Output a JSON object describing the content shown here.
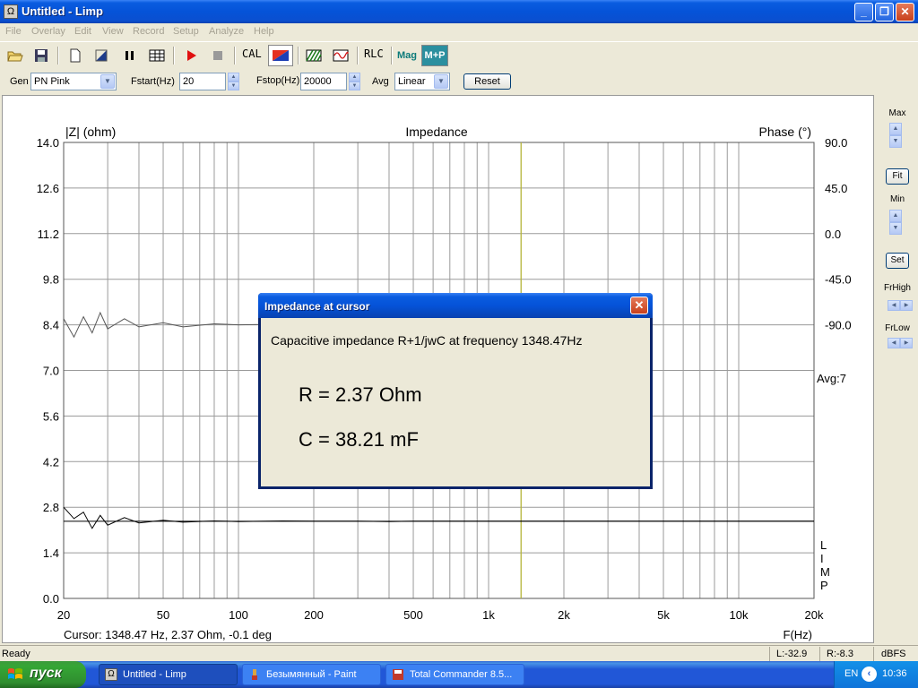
{
  "window": {
    "title": "Untitled - Limp",
    "app_icon": "ohm-icon",
    "app_icon_glyph": "Ω",
    "minimize": "_",
    "restore": "❐",
    "close": "✕"
  },
  "menu": [
    "File",
    "Overlay",
    "Edit",
    "View",
    "Record",
    "Setup",
    "Analyze",
    "Help"
  ],
  "toolbar": {
    "cal": "CAL",
    "rlc": "RLC",
    "mag": "Mag",
    "mp": "M+P",
    "colors": {
      "mag": "#0b7a7a",
      "mp_bg": "#2b8f9f"
    }
  },
  "controls": {
    "gen_label": "Gen",
    "gen_value": "PN Pink",
    "fstart_label": "Fstart(Hz)",
    "fstart_value": "20",
    "fstop_label": "Fstop(Hz)",
    "fstop_value": "20000",
    "avg_label": "Avg",
    "avg_value": "Linear",
    "reset": "Reset"
  },
  "plot": {
    "title": "Impedance",
    "left_axis_label": "|Z| (ohm)",
    "right_axis_label": "Phase (°)",
    "x_axis_label": "F(Hz)",
    "left_ticks": [
      "14.0",
      "12.6",
      "11.2",
      "9.8",
      "8.4",
      "7.0",
      "5.6",
      "4.2",
      "2.8",
      "1.4",
      "0.0"
    ],
    "right_ticks": [
      "90.0",
      "45.0",
      "0.0",
      "-45.0",
      "-90.0"
    ],
    "x_ticks": [
      "20",
      "50",
      "100",
      "200",
      "500",
      "1k",
      "2k",
      "5k",
      "10k",
      "20k"
    ],
    "avg_label": "Avg:7",
    "limp_letters": [
      "L",
      "I",
      "M",
      "P"
    ],
    "cursor_readout": "Cursor: 1348.47 Hz, 2.37 Ohm, -0.1 deg",
    "cursor_color": "#b5b53a"
  },
  "chart_data": {
    "type": "line",
    "title": "Impedance",
    "xlabel": "F(Hz)",
    "ylabel": "|Z| (ohm)",
    "y2label": "Phase (°)",
    "x_scale": "log",
    "xlim": [
      20,
      20000
    ],
    "ylim": [
      0,
      14
    ],
    "y2lim": [
      -135,
      90
    ],
    "grid": true,
    "cursor_frequency_hz": 1348.47,
    "series": [
      {
        "color": "#000000",
        "axis": "left",
        "x": [
          20,
          22,
          24,
          26,
          28,
          30,
          35,
          40,
          50,
          60,
          80,
          100,
          150,
          200,
          300,
          400,
          500,
          560,
          700,
          1000,
          1348.47,
          2000,
          5000,
          10000,
          20000
        ],
        "y": [
          2.8,
          2.45,
          2.65,
          2.15,
          2.55,
          2.25,
          2.48,
          2.32,
          2.4,
          2.34,
          2.38,
          2.36,
          2.38,
          2.37,
          2.37,
          2.36,
          2.37,
          2.37,
          2.37,
          2.37,
          2.37,
          2.37,
          2.37,
          2.37,
          2.37
        ]
      },
      {
        "color": "#555555",
        "axis": "right",
        "x": [
          20,
          22,
          24,
          26,
          28,
          30,
          35,
          40,
          50,
          60,
          80,
          100,
          150,
          200,
          300,
          400,
          500,
          600,
          700,
          900
        ],
        "y": [
          3,
          -6,
          4,
          -4,
          6,
          -2,
          3,
          -1,
          1,
          -1,
          0.5,
          0,
          0.3,
          0,
          0,
          0,
          0,
          0,
          0,
          0
        ]
      }
    ]
  },
  "right_panel": {
    "max": "Max",
    "fit": "Fit",
    "min": "Min",
    "set": "Set",
    "frhigh": "FrHigh",
    "frlow": "FrLow"
  },
  "dialog": {
    "title": "Impedance at cursor",
    "description": "Capacitive impedance R+1/jwC at frequency 1348.47Hz",
    "r_value": "R = 2.37 Ohm",
    "c_value": "C = 38.21 mF"
  },
  "statusbar": {
    "status": "Ready",
    "left_level": "L:-32.9",
    "right_level": "R:-8.3",
    "unit": "dBFS"
  },
  "taskbar": {
    "start": "пуск",
    "tasks": [
      "Untitled - Limp",
      "Безымянный - Paint",
      "Total Commander 8.5..."
    ],
    "lang": "EN",
    "clock": "10:36"
  }
}
